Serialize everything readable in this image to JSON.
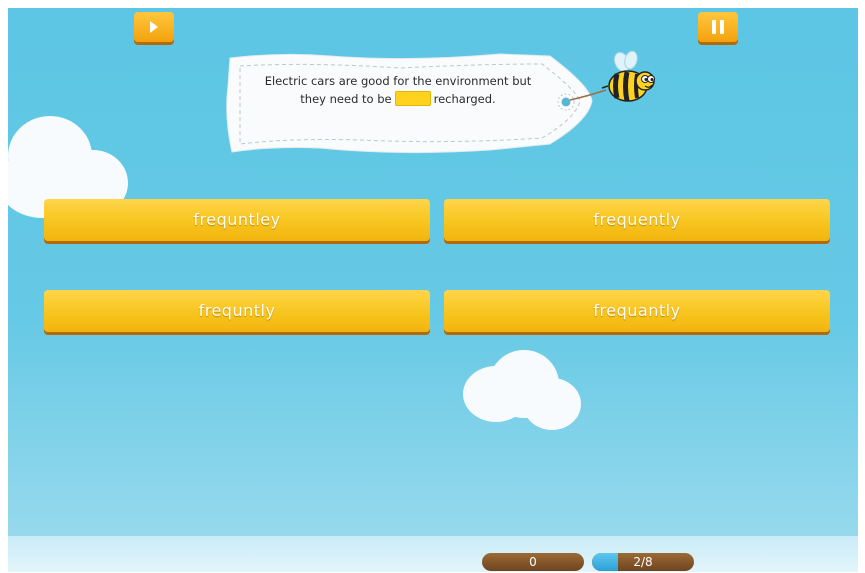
{
  "controls": {
    "play_icon": "play-icon",
    "pause_icon": "pause-icon",
    "accent_color": "#f7c51e"
  },
  "question": {
    "line1": "Electric cars are good for the environment but",
    "line2_before": "they need to be",
    "line2_after": "recharged."
  },
  "answers": [
    {
      "label": "frequntley"
    },
    {
      "label": "frequently"
    },
    {
      "label": "frequntly"
    },
    {
      "label": "frequantly"
    }
  ],
  "status": {
    "score": "0",
    "progress_label": "2/8",
    "progress_fraction": 0.25
  }
}
